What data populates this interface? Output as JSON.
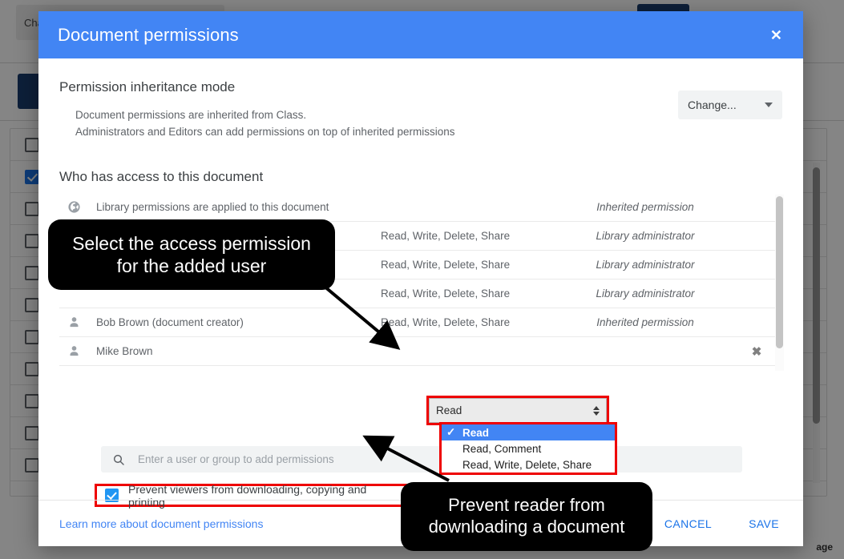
{
  "background": {
    "toolbar_label": "Chan",
    "footer_text": "age",
    "rows": [
      {
        "checked": false
      },
      {
        "checked": true
      },
      {
        "checked": false
      },
      {
        "checked": false
      },
      {
        "checked": false
      },
      {
        "checked": false
      },
      {
        "checked": false
      },
      {
        "checked": false
      },
      {
        "checked": false
      },
      {
        "checked": false
      },
      {
        "checked": false
      }
    ]
  },
  "modal": {
    "title": "Document permissions",
    "close_icon": "close-icon",
    "inheritance": {
      "heading": "Permission inheritance mode",
      "line1": "Document permissions are inherited from Class.",
      "line2": "Administrators and Editors can add permissions on top of inherited permissions",
      "change_button": "Change..."
    },
    "access": {
      "heading": "Who has access to this document",
      "library_note": "Library permissions are applied to this document",
      "inherited_header": "Inherited permission",
      "rows": [
        {
          "icon": "globe-icon",
          "name": "",
          "permission": "",
          "source": "Inherited permission",
          "removable": false
        },
        {
          "icon": "none",
          "name": "",
          "permission": "Read, Write, Delete, Share",
          "source": "Library administrator",
          "removable": false
        },
        {
          "icon": "none",
          "name": "",
          "permission": "Read, Write, Delete, Share",
          "source": "Library administrator",
          "removable": false
        },
        {
          "icon": "none",
          "name": "",
          "permission": "Read, Write, Delete, Share",
          "source": "Library administrator",
          "removable": false
        },
        {
          "icon": "person-icon",
          "name": "Bob Brown (document creator)",
          "permission": "Read, Write, Delete, Share",
          "source": "Inherited permission",
          "removable": false
        },
        {
          "icon": "person-icon",
          "name": "Mike Brown",
          "permission": "",
          "source": "",
          "removable": true,
          "remove_icon": "remove-icon"
        }
      ]
    },
    "permission_select": {
      "value": "Read",
      "options": [
        {
          "label": "Read",
          "selected": true,
          "check": "✓"
        },
        {
          "label": "Read, Comment",
          "selected": false,
          "check": ""
        },
        {
          "label": "Read, Write, Delete, Share",
          "selected": false,
          "check": ""
        }
      ]
    },
    "search": {
      "icon": "search-icon",
      "placeholder": "Enter a user or group to add permissions",
      "value": ""
    },
    "prevent_checkbox": {
      "label": "Prevent viewers from downloading, copying and printing",
      "checked": true
    },
    "footer": {
      "learn_more": "Learn more about document permissions",
      "cancel": "CANCEL",
      "save": "SAVE"
    }
  },
  "callouts": [
    {
      "id": "callout-1",
      "text": "Select the access permission for the added user"
    },
    {
      "id": "callout-2",
      "text": "Prevent reader from downloading a document"
    }
  ],
  "colors": {
    "header_blue": "#4285f4",
    "highlight_red": "#ee0000",
    "link_blue": "#1a73e8",
    "checkbox_blue": "#2196f3",
    "callout_bg": "#000000"
  }
}
